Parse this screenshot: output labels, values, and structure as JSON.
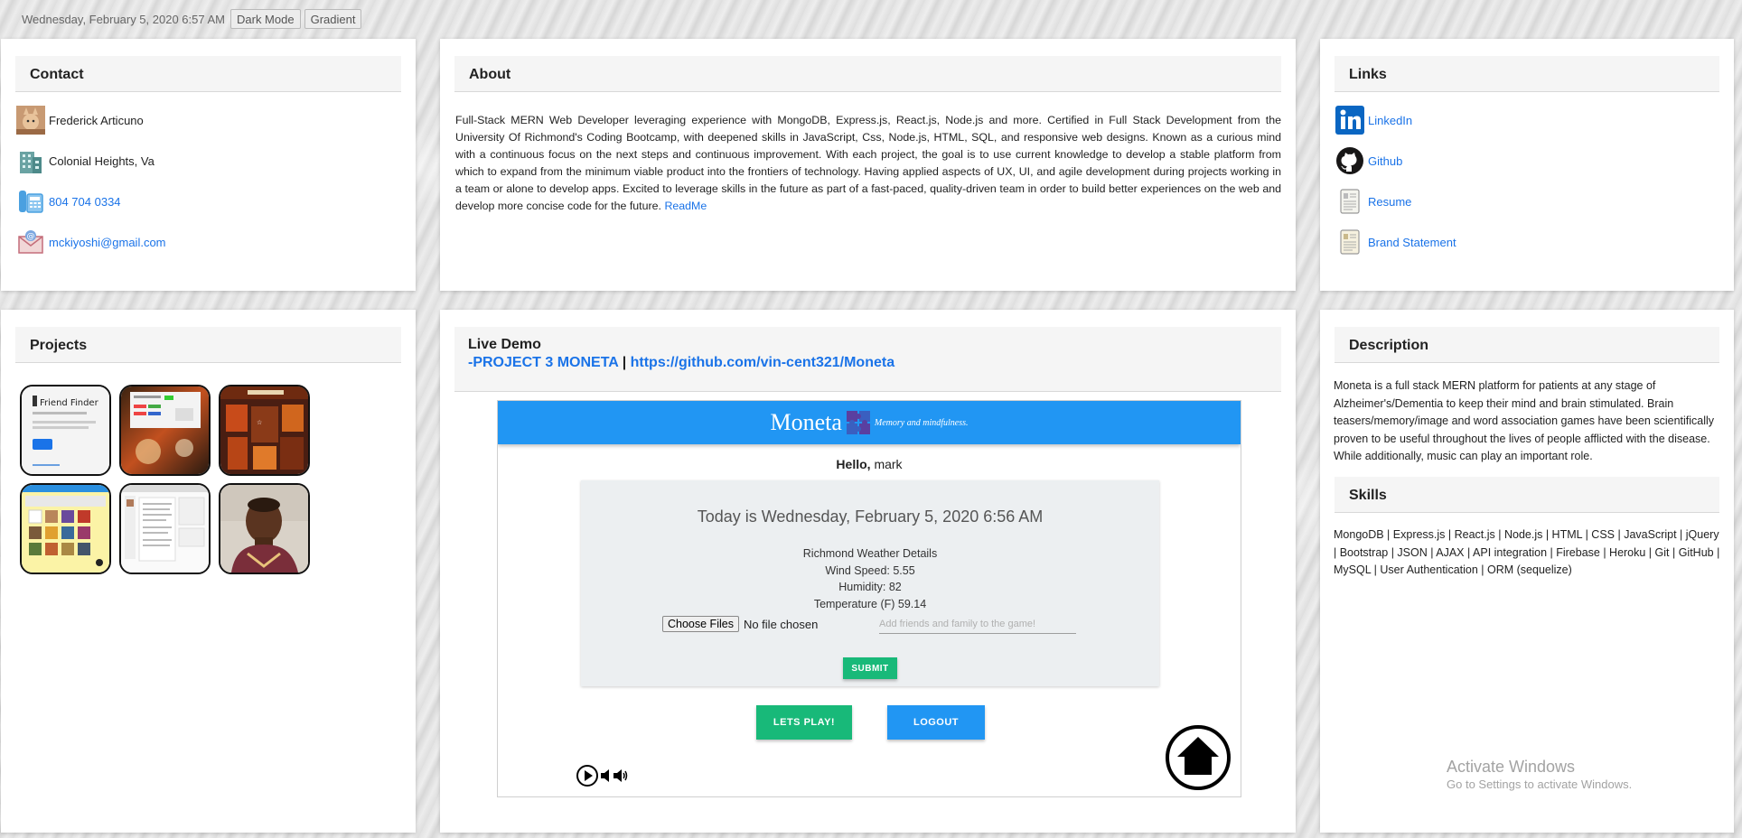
{
  "topbar": {
    "datetime": "Wednesday, February 5, 2020 6:57 AM",
    "dark_mode_label": "Dark Mode",
    "gradient_label": "Gradient"
  },
  "contact": {
    "title": "Contact",
    "name": "Frederick Articuno",
    "location": "Colonial Heights, Va",
    "phone": "804 704 0334",
    "email": "mckiyoshi@gmail.com"
  },
  "about": {
    "title": "About",
    "text": "Full-Stack MERN Web Developer leveraging experience with MongoDB, Express.js, React.js, Node.js and more. Certified in Full Stack Development from the University Of Richmond's Coding Bootcamp, with deepened skills in JavaScript, Css, Node.js, HTML, SQL, and responsive web designs. Known as a curious mind with a continuous focus on the next steps and continuous improvement. With each project, the goal is to use current knowledge to develop a stable platform from which to expand from the minimum viable product into the frontiers of technology. Having applied aspects of UX, UI, and agile development during projects working in a team or alone to develop apps. Excited to leverage skills in the future as part of a fast-paced, quality-driven team in order to build better experiences on the web and develop more concise code for the future.",
    "readme_label": "ReadMe"
  },
  "links": {
    "title": "Links",
    "items": [
      {
        "label": "LinkedIn",
        "icon": "linkedin-icon"
      },
      {
        "label": "Github",
        "icon": "github-icon"
      },
      {
        "label": "Resume",
        "icon": "document-icon"
      },
      {
        "label": "Brand Statement",
        "icon": "document-icon"
      }
    ]
  },
  "projects": {
    "title": "Projects",
    "thumb1_title": "Friend Finder"
  },
  "live_demo": {
    "title": "Live Demo",
    "project_link": "-PROJECT 3 MONETA",
    "separator": "|",
    "repo_link": "https://github.com/vin-cent321/Moneta",
    "app": {
      "brand": "Moneta",
      "tagline": "Memory and mindfulness.",
      "hello_prefix": "Hello,",
      "hello_user": "mark",
      "today": "Today is Wednesday, February 5, 2020 6:56 AM",
      "weather_title": "Richmond Weather Details",
      "wind": "Wind Speed: 5.55",
      "humidity": "Humidity: 82",
      "temperature": "Temperature (F) 59.14",
      "choose_files": "Choose Files",
      "no_file": "No file chosen",
      "friends_placeholder": "Add friends and family to the game!",
      "submit": "SUBMIT",
      "lets_play": "LETS PLAY!",
      "logout": "LOGOUT"
    }
  },
  "description": {
    "title": "Description",
    "text": "Moneta is a full stack MERN platform for patients at any stage of Alzheimer's/Dementia to keep their mind and brain stimulated. Brain teasers/memory/image and word association games have been scientifically proven to be useful throughout the lives of people afflicted with the disease. While additionally, music can play an important role."
  },
  "skills": {
    "title": "Skills",
    "text": "MongoDB | Express.js | React.js | Node.js | HTML | CSS | JavaScript | jQuery | Bootstrap | JSON | AJAX | API integration | Firebase | Heroku | Git | GitHub | MySQL | User Authentication | ORM (sequelize)"
  },
  "watermark": {
    "line1": "Activate Windows",
    "line2": "Go to Settings to activate Windows."
  },
  "colors": {
    "link": "#1a73e8",
    "moneta_blue": "#2196f3",
    "moneta_green": "#18b979",
    "linkedin": "#0a66c2"
  }
}
